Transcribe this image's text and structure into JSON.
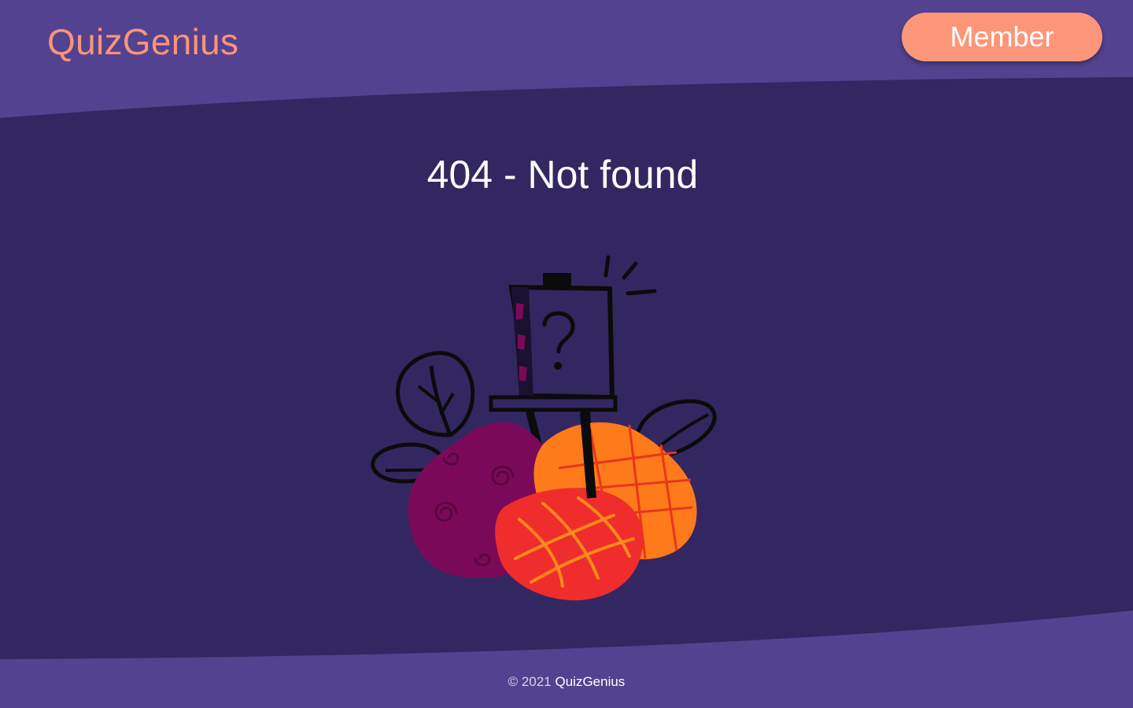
{
  "header": {
    "logo_text": "QuizGenius",
    "member_label": "Member"
  },
  "main": {
    "title": "404 - Not found",
    "illustration_icon": "easel-question-mark-illustration"
  },
  "footer": {
    "copyright": "© 2021",
    "brand_link": "QuizGenius"
  },
  "colors": {
    "header_bg": "#53428f",
    "main_bg": "#332762",
    "accent": "#fa9479",
    "text": "#ffffff"
  }
}
